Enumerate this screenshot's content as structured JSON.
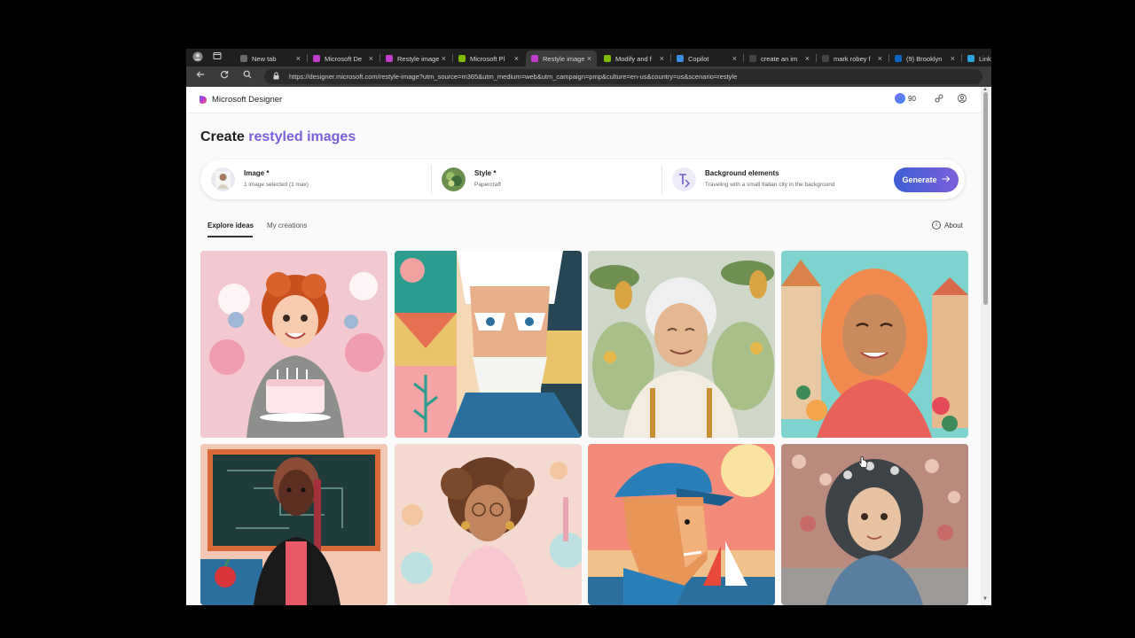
{
  "browser": {
    "tabs": [
      {
        "label": "New tab",
        "favicon_color": "#6b6b6b",
        "active": false
      },
      {
        "label": "Microsoft De",
        "favicon_color": "#c13cce",
        "active": false
      },
      {
        "label": "Restyle image",
        "favicon_color": "#c13cce",
        "active": false
      },
      {
        "label": "Microsoft Pl",
        "favicon_color": "#7fba00",
        "active": false
      },
      {
        "label": "Restyle image",
        "favicon_color": "#c13cce",
        "active": true
      },
      {
        "label": "Modify and f",
        "favicon_color": "#7fba00",
        "active": false
      },
      {
        "label": "Copilot",
        "favicon_color": "#3a8ee6",
        "active": false
      },
      {
        "label": "create an im",
        "favicon_color": "#444444",
        "active": false
      },
      {
        "label": "mark robey f",
        "favicon_color": "#444444",
        "active": false
      },
      {
        "label": "(9) Brooklyn",
        "favicon_color": "#0a66c2",
        "active": false
      },
      {
        "label": "Link",
        "favicon_color": "#2aa3e0",
        "active": false
      }
    ],
    "close_glyph": "×",
    "url": "https://designer.microsoft.com/restyle-image?utm_source=m365&utm_medium=web&utm_campaign=pmp&culture=en-us&country=us&scenario=restyle"
  },
  "app": {
    "name": "Microsoft Designer",
    "credits": "90"
  },
  "page": {
    "title_prefix": "Create",
    "title_accent": "restyled images",
    "image_field": {
      "label": "Image *",
      "sub": "1 image selected (1 max)"
    },
    "style_field": {
      "label": "Style *",
      "sub": "Papercraft"
    },
    "background_field": {
      "label": "Background elements",
      "sub": "Traveling with a small Italian city in the background"
    },
    "generate_label": "Generate",
    "tabs": [
      "Explore ideas",
      "My creations"
    ],
    "about_label": "About"
  },
  "gallery": [
    {
      "name": "card-birthday-girl"
    },
    {
      "name": "card-geometric-old-man"
    },
    {
      "name": "card-papercraft-grandma"
    },
    {
      "name": "card-hijab-woman"
    },
    {
      "name": "card-chalkboard-woman"
    },
    {
      "name": "card-curly-hair-woman"
    },
    {
      "name": "card-baseball-cap-man"
    },
    {
      "name": "card-clay-girl"
    }
  ],
  "colors": {
    "accent": "#7b5fd9",
    "generate_start": "#3e5fd6",
    "generate_end": "#7b5fd9",
    "tab_strip": "#1f1f1f",
    "toolbar": "#3b3b3b"
  }
}
